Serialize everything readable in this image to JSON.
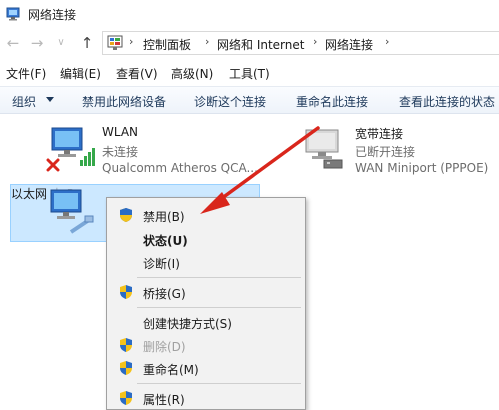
{
  "window": {
    "title": "网络连接",
    "icon": "network-connections-icon"
  },
  "nav": {
    "back_icon": "back-arrow-icon",
    "forward_icon": "forward-arrow-icon",
    "recent_icon": "chevron-down-icon",
    "up_icon": "up-arrow-icon"
  },
  "address": {
    "icon": "control-panel-icon",
    "crumbs": [
      "控制面板",
      "网络和 Internet",
      "网络连接"
    ]
  },
  "menubar": [
    "文件(F)",
    "编辑(E)",
    "查看(V)",
    "高级(N)",
    "工具(T)"
  ],
  "commandbar": {
    "organize": "组织",
    "items": [
      "禁用此网络设备",
      "诊断这个连接",
      "重命名此连接",
      "查看此连接的状态"
    ]
  },
  "adapters": [
    {
      "name": "WLAN",
      "status": "未连接",
      "device": "Qualcomm Atheros QCA...",
      "icon": "wifi-adapter-icon",
      "badge": "disconnected-x-icon"
    },
    {
      "name": "宽带连接",
      "status": "已断开连接",
      "device": "WAN Miniport (PPPOE)",
      "icon": "broadband-adapter-icon"
    },
    {
      "name": "以太网",
      "status": "",
      "device": "",
      "icon": "ethernet-adapter-icon"
    }
  ],
  "context_menu": {
    "items": [
      {
        "label": "禁用(B)",
        "shield": true,
        "bold": false,
        "disabled": false
      },
      {
        "label": "状态(U)",
        "shield": false,
        "bold": true,
        "disabled": false
      },
      {
        "label": "诊断(I)",
        "shield": false,
        "bold": false,
        "disabled": false
      },
      {
        "label": "桥接(G)",
        "shield": true,
        "bold": false,
        "disabled": false
      },
      {
        "label": "创建快捷方式(S)",
        "shield": false,
        "bold": false,
        "disabled": false
      },
      {
        "label": "删除(D)",
        "shield": true,
        "bold": false,
        "disabled": true
      },
      {
        "label": "重命名(M)",
        "shield": true,
        "bold": false,
        "disabled": false
      },
      {
        "label": "属性(R)",
        "shield": true,
        "bold": false,
        "disabled": false
      }
    ]
  },
  "colors": {
    "accent_arrow": "#d9261c",
    "selection": "#cce8ff",
    "shield_blue": "#2b6cc4",
    "shield_yellow": "#f4c21b"
  }
}
